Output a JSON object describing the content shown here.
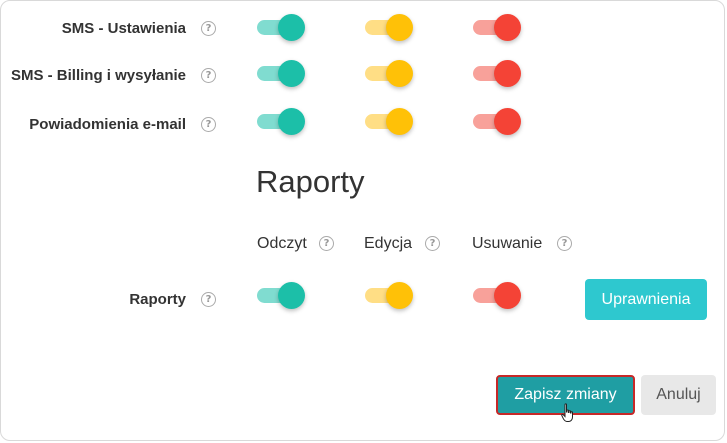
{
  "permissions": {
    "rows": [
      {
        "label": "SMS - Ustawienia",
        "read": true,
        "edit": true,
        "delete": true
      },
      {
        "label": "SMS - Billing i wysyłanie",
        "read": true,
        "edit": true,
        "delete": true
      },
      {
        "label": "Powiadomienia e-mail",
        "read": true,
        "edit": true,
        "delete": true
      }
    ]
  },
  "reports": {
    "title": "Raporty",
    "columns": {
      "read": "Odczyt",
      "edit": "Edycja",
      "delete": "Usuwanie"
    },
    "row": {
      "label": "Raporty",
      "read": true,
      "edit": true,
      "delete": true
    },
    "permissions_button": "Uprawnienia"
  },
  "icons": {
    "help": "?"
  },
  "colors": {
    "read_on": "#1cbfa8",
    "edit_on": "#ffc107",
    "delete_on": "#f44336",
    "primary": "#1f9ea3",
    "accent": "#2ec8cf"
  },
  "footer": {
    "save_label": "Zapisz zmiany",
    "cancel_label": "Anuluj"
  }
}
